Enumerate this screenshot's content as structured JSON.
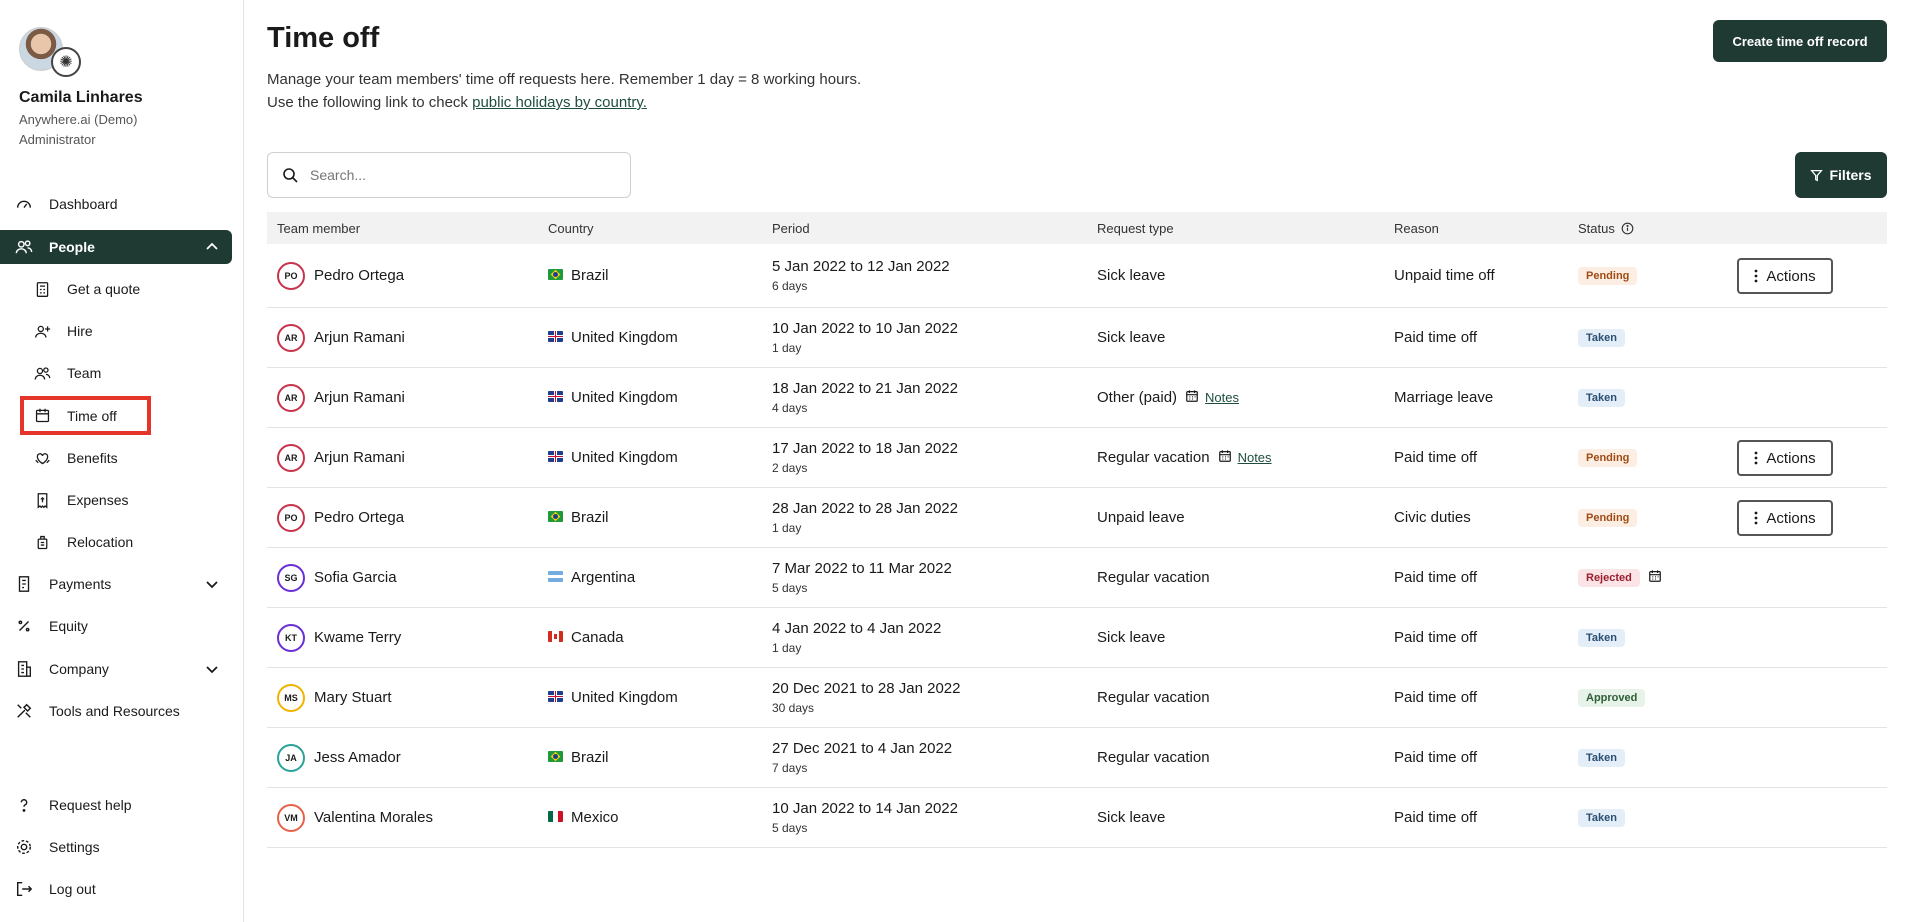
{
  "user": {
    "name": "Camila Linhares",
    "company": "Anywhere.ai (Demo)",
    "role": "Administrator"
  },
  "nav": {
    "dashboard": "Dashboard",
    "people": "People",
    "get_quote": "Get a quote",
    "hire": "Hire",
    "team": "Team",
    "time_off": "Time off",
    "benefits": "Benefits",
    "expenses": "Expenses",
    "relocation": "Relocation",
    "payments": "Payments",
    "equity": "Equity",
    "company": "Company",
    "tools": "Tools and Resources",
    "request_help": "Request help",
    "settings": "Settings",
    "log_out": "Log out"
  },
  "page": {
    "title": "Time off",
    "desc1": "Manage your team members' time off requests here. Remember 1 day = 8 working hours.",
    "desc2_prefix": "Use the following link to check ",
    "desc2_link": "public holidays by country.",
    "create_button": "Create time off record",
    "search_placeholder": "Search...",
    "filters_button": "Filters"
  },
  "table": {
    "headers": {
      "member": "Team member",
      "country": "Country",
      "period": "Period",
      "request_type": "Request type",
      "reason": "Reason",
      "status": "Status"
    },
    "actions_label": "Actions",
    "notes_label": "Notes",
    "rows": [
      {
        "initials": "PO",
        "name": "Pedro Ortega",
        "country": "Brazil",
        "flag": "br",
        "period": "5 Jan 2022 to 12 Jan 2022",
        "days": "6 days",
        "type": "Sick leave",
        "reason": "Unpaid time off",
        "status": "Pending",
        "status_kind": "pending",
        "color": "#c8334a"
      },
      {
        "initials": "AR",
        "name": "Arjun Ramani",
        "country": "United Kingdom",
        "flag": "uk",
        "period": "10 Jan 2022 to 10 Jan 2022",
        "days": "1 day",
        "type": "Sick leave",
        "reason": "Paid time off",
        "status": "Taken",
        "status_kind": "taken",
        "color": "#c8334a"
      },
      {
        "initials": "AR",
        "name": "Arjun Ramani",
        "country": "United Kingdom",
        "flag": "uk",
        "period": "18 Jan 2022 to 21 Jan 2022",
        "days": "4 days",
        "type": "Other (paid)",
        "reason": "Marriage leave",
        "status": "Taken",
        "status_kind": "taken",
        "color": "#c8334a"
      },
      {
        "initials": "AR",
        "name": "Arjun Ramani",
        "country": "United Kingdom",
        "flag": "uk",
        "period": "17 Jan 2022 to 18 Jan 2022",
        "days": "2 days",
        "type": "Regular vacation",
        "reason": "Paid time off",
        "status": "Pending",
        "status_kind": "pending",
        "color": "#c8334a"
      },
      {
        "initials": "PO",
        "name": "Pedro Ortega",
        "country": "Brazil",
        "flag": "br",
        "period": "28 Jan 2022 to 28 Jan 2022",
        "days": "1 day",
        "type": "Unpaid leave",
        "reason": "Civic duties",
        "status": "Pending",
        "status_kind": "pending",
        "color": "#c8334a"
      },
      {
        "initials": "SG",
        "name": "Sofia Garcia",
        "country": "Argentina",
        "flag": "ar",
        "period": "7 Mar 2022 to 11 Mar 2022",
        "days": "5 days",
        "type": "Regular vacation",
        "reason": "Paid time off",
        "status": "Rejected",
        "status_kind": "rejected",
        "color": "#6b2fd6"
      },
      {
        "initials": "KT",
        "name": "Kwame Terry",
        "country": "Canada",
        "flag": "ca",
        "period": "4 Jan 2022 to 4 Jan 2022",
        "days": "1 day",
        "type": "Sick leave",
        "reason": "Paid time off",
        "status": "Taken",
        "status_kind": "taken",
        "color": "#6b2fd6"
      },
      {
        "initials": "MS",
        "name": "Mary Stuart",
        "country": "United Kingdom",
        "flag": "uk",
        "period": "20 Dec 2021 to 28 Jan 2022",
        "days": "30 days",
        "type": "Regular vacation",
        "reason": "Paid time off",
        "status": "Approved",
        "status_kind": "approved",
        "color": "#f0b400"
      },
      {
        "initials": "JA",
        "name": "Jess Amador",
        "country": "Brazil",
        "flag": "br",
        "period": "27 Dec 2021 to 4 Jan 2022",
        "days": "7 days",
        "type": "Regular vacation",
        "reason": "Paid time off",
        "status": "Taken",
        "status_kind": "taken",
        "color": "#2aa39a"
      },
      {
        "initials": "VM",
        "name": "Valentina Morales",
        "country": "Mexico",
        "flag": "mx",
        "period": "10 Jan 2022 to 14 Jan 2022",
        "days": "5 days",
        "type": "Sick leave",
        "reason": "Paid time off",
        "status": "Taken",
        "status_kind": "taken",
        "color": "#e8624a"
      }
    ]
  }
}
